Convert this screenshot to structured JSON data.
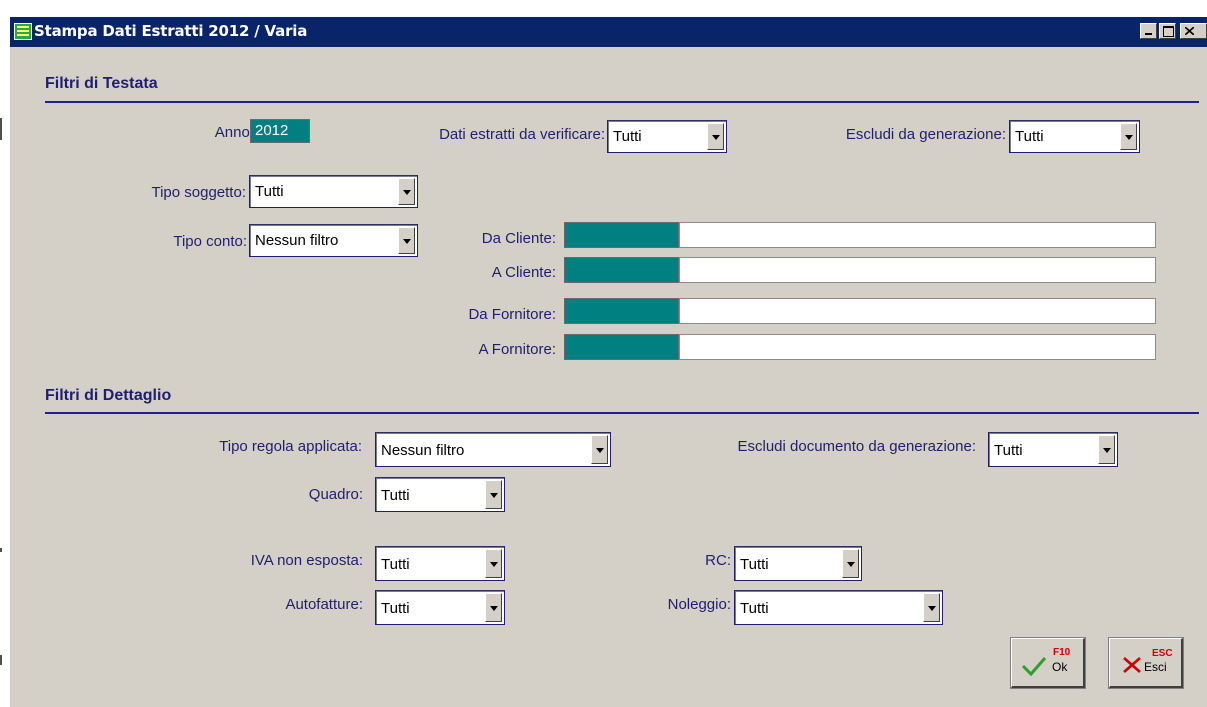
{
  "window": {
    "title": "Stampa Dati Estratti 2012 / Varia"
  },
  "header_filters": {
    "section_title": "Filtri di Testata",
    "anno": {
      "label": "Anno:",
      "value": "2012"
    },
    "dati_estratti": {
      "label": "Dati estratti da verificare:",
      "value": "Tutti"
    },
    "escludi_generazione": {
      "label": "Escludi da generazione:",
      "value": "Tutti"
    },
    "tipo_soggetto": {
      "label": "Tipo soggetto:",
      "value": "Tutti"
    },
    "tipo_conto": {
      "label": "Tipo conto:",
      "value": "Nessun filtro"
    },
    "da_cliente": {
      "label": "Da Cliente:",
      "code": "",
      "description": ""
    },
    "a_cliente": {
      "label": "A Cliente:",
      "code": "",
      "description": ""
    },
    "da_fornitore": {
      "label": "Da Fornitore:",
      "code": "",
      "description": ""
    },
    "a_fornitore": {
      "label": "A Fornitore:",
      "code": "",
      "description": ""
    }
  },
  "detail_filters": {
    "section_title": "Filtri di Dettaglio",
    "tipo_regola": {
      "label": "Tipo regola applicata:",
      "value": "Nessun filtro"
    },
    "escludi_documento": {
      "label": "Escludi documento da generazione:",
      "value": "Tutti"
    },
    "quadro": {
      "label": "Quadro:",
      "value": "Tutti"
    },
    "iva_non_esposta": {
      "label": "IVA non esposta:",
      "value": "Tutti"
    },
    "rc": {
      "label": "RC:",
      "value": "Tutti"
    },
    "autofatture": {
      "label": "Autofatture:",
      "value": "Tutti"
    },
    "noleggio": {
      "label": "Noleggio:",
      "value": "Tutti"
    }
  },
  "buttons": {
    "ok": {
      "key": "F10",
      "label": "Ok"
    },
    "esci": {
      "key": "ESC",
      "label": "Esci"
    }
  },
  "colors": {
    "title_bar": "#0a246a",
    "window_bg": "#d4d0c8",
    "label_text": "#1f1f6e",
    "teal_field": "#008080",
    "ok_check": "#2e9e2e",
    "esci_x": "#cc0000"
  }
}
